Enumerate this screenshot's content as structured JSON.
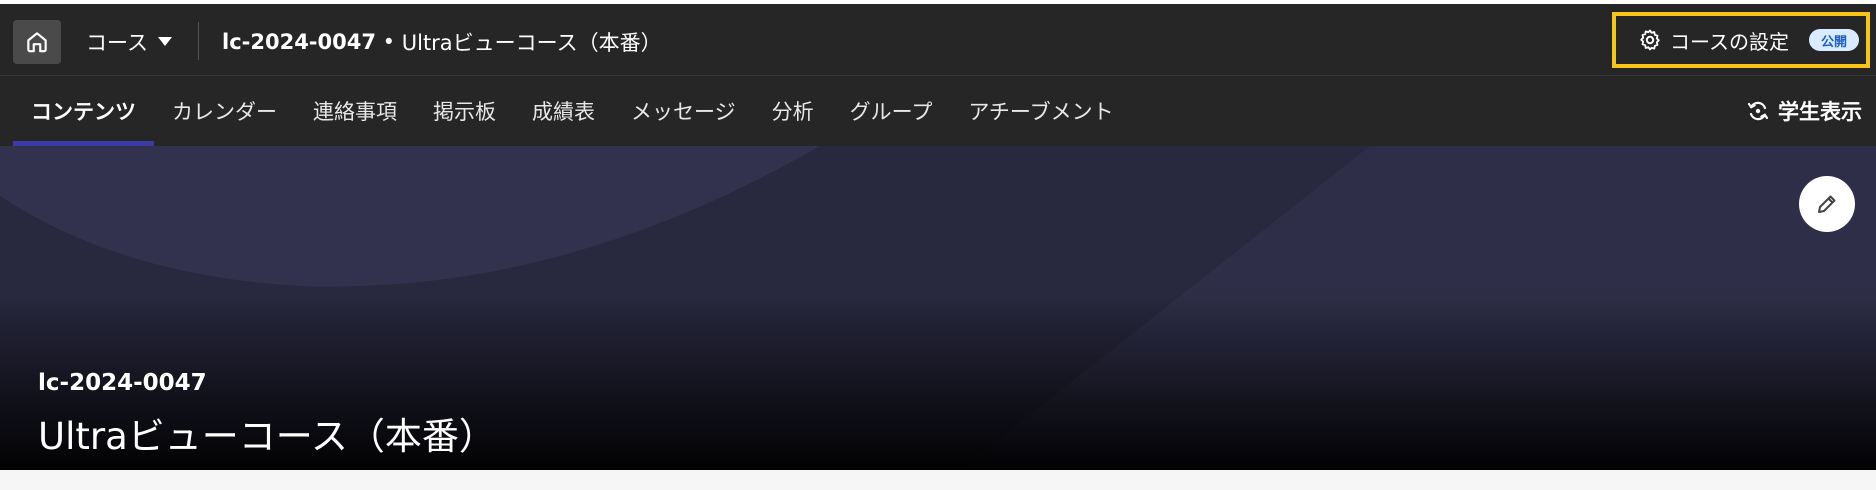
{
  "header": {
    "home_icon": "home-icon",
    "course_menu_label": "コース",
    "course_menu_icon": "caret-down-icon",
    "course_code": "lc-2024-0047",
    "separator": " • ",
    "course_name": "Ultraビューコース（本番）",
    "settings_icon": "gear-icon",
    "settings_label": "コースの設定",
    "status_badge": "公開"
  },
  "tabs": [
    {
      "label": "コンテンツ",
      "active": true
    },
    {
      "label": "カレンダー"
    },
    {
      "label": "連絡事項"
    },
    {
      "label": "掲示板"
    },
    {
      "label": "成績表"
    },
    {
      "label": "メッセージ"
    },
    {
      "label": "分析"
    },
    {
      "label": "グループ"
    },
    {
      "label": "アチーブメント"
    }
  ],
  "student_view": {
    "icon": "refresh-icon",
    "label": "学生表示"
  },
  "banner": {
    "edit_icon": "pencil-icon",
    "course_code": "lc-2024-0047",
    "course_title": "Ultraビューコース（本番）"
  },
  "colors": {
    "header_bg": "#262626",
    "highlight_border": "#f5c518",
    "active_tab_underline": "#3d3aa8",
    "badge_bg": "#d9ebff",
    "badge_text": "#1f5fc4",
    "banner_bg": "#2b2b45"
  }
}
